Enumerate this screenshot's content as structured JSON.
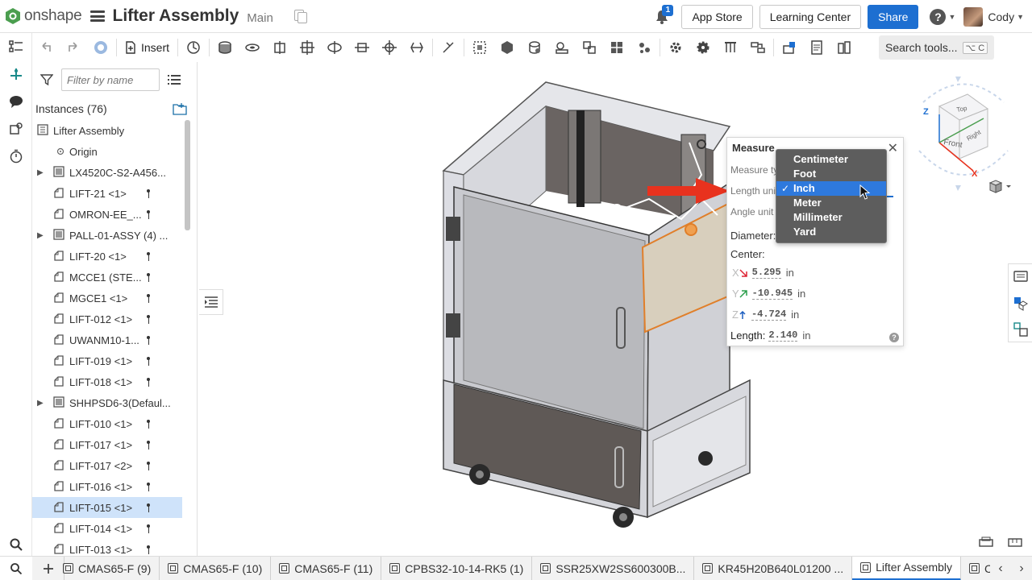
{
  "header": {
    "logo_text": "onshape",
    "doc_title": "Lifter Assembly",
    "workspace": "Main",
    "notification_count": "1",
    "app_store": "App Store",
    "learning_center": "Learning Center",
    "share": "Share",
    "help": "?",
    "user": "Cody"
  },
  "toolbar": {
    "insert_label": "Insert",
    "search_label": "Search tools...",
    "search_kbd": "⌥ C"
  },
  "panel": {
    "filter_placeholder": "Filter by name",
    "instances_label": "Instances (76)",
    "tree": [
      {
        "label": "Lifter Assembly",
        "type": "root"
      },
      {
        "label": "Origin",
        "type": "origin"
      },
      {
        "label": "LX4520C-S2-A456...",
        "type": "subasm",
        "expandable": true
      },
      {
        "label": "LIFT-21 <1>",
        "type": "part",
        "pinned": true
      },
      {
        "label": "OMRON-EE_...",
        "type": "part",
        "pinned": true
      },
      {
        "label": "PALL-01-ASSY (4) ...",
        "type": "subasm",
        "expandable": true
      },
      {
        "label": "LIFT-20 <1>",
        "type": "part",
        "pinned": true
      },
      {
        "label": "MCCE1 (STE...",
        "type": "part",
        "pinned": true
      },
      {
        "label": "MGCE1 <1>",
        "type": "part",
        "pinned": true
      },
      {
        "label": "LIFT-012 <1>",
        "type": "part",
        "pinned": true
      },
      {
        "label": "UWANM10-1...",
        "type": "part",
        "pinned": true
      },
      {
        "label": "LIFT-019 <1>",
        "type": "part",
        "pinned": true
      },
      {
        "label": "LIFT-018 <1>",
        "type": "part",
        "pinned": true
      },
      {
        "label": "SHHPSD6-3(Defaul...",
        "type": "subasm",
        "expandable": true
      },
      {
        "label": "LIFT-010 <1>",
        "type": "part",
        "pinned": true
      },
      {
        "label": "LIFT-017 <1>",
        "type": "part",
        "pinned": true
      },
      {
        "label": "LIFT-017 <2>",
        "type": "part",
        "pinned": true
      },
      {
        "label": "LIFT-016 <1>",
        "type": "part",
        "pinned": true
      },
      {
        "label": "LIFT-015 <1>",
        "type": "part",
        "pinned": true,
        "selected": true
      },
      {
        "label": "LIFT-014 <1>",
        "type": "part",
        "pinned": true
      },
      {
        "label": "LIFT-013 <1>",
        "type": "part",
        "pinned": true
      }
    ]
  },
  "measure": {
    "title": "Measure",
    "measure_type_label": "Measure ty",
    "length_units_label": "Length unit",
    "angle_units_label": "Angle unit",
    "diameter_label": "Diameter:",
    "center_label": "Center:",
    "x_label": "X",
    "x_value": "5.295",
    "y_label": "Y",
    "y_value": "-10.945",
    "z_label": "Z",
    "z_value": "-4.724",
    "unit": "in",
    "length_label": "Length:",
    "length_value": "2.140",
    "help": "?"
  },
  "units_dropdown": {
    "options": [
      "Centimeter",
      "Foot",
      "Inch",
      "Meter",
      "Millimeter",
      "Yard"
    ],
    "selected": "Inch"
  },
  "view_cube": {
    "top": "Top",
    "front": "Front",
    "right": "Right",
    "axis_z": "Z",
    "axis_x": "X"
  },
  "bottom_tabs": [
    {
      "label": "CMAS65-F (9)"
    },
    {
      "label": "CMAS65-F (10)"
    },
    {
      "label": "CMAS65-F (11)"
    },
    {
      "label": "CPBS32-10-14-RK5 (1)"
    },
    {
      "label": "SSR25XW2SS600300B..."
    },
    {
      "label": "KR45H20B640L01200 ..."
    },
    {
      "label": "Lifter Assembly",
      "active": true
    },
    {
      "label": "C"
    }
  ],
  "colors": {
    "accent": "#1d6fd1",
    "selection": "#cfe3fa",
    "dropdown_bg": "#5d5d5d",
    "dropdown_selected": "#2e79dd",
    "arrow": "#e8321e"
  }
}
